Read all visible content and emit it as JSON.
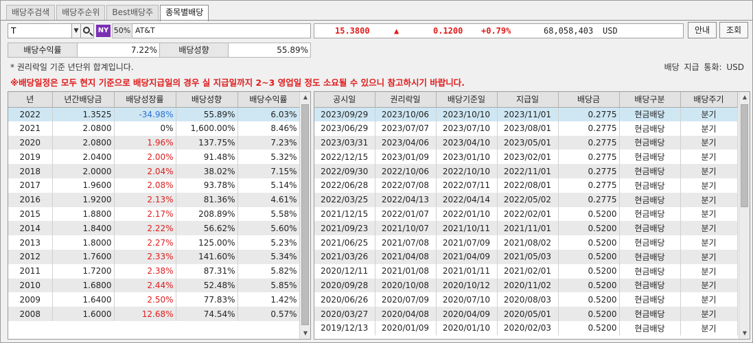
{
  "tabs": [
    {
      "label": "배당주검색",
      "active": false
    },
    {
      "label": "배당주순위",
      "active": false
    },
    {
      "label": "Best배당주",
      "active": false
    },
    {
      "label": "종목별배당",
      "active": true
    }
  ],
  "ticker": {
    "code": "T",
    "exchange_badge": "NY",
    "margin": "50%",
    "name": "AT&T"
  },
  "quote": {
    "price": "15.3800",
    "direction_icon": "up-triangle-icon",
    "direction_symbol": "▲",
    "change": "0.1200",
    "change_pct": "+0.79%",
    "volume": "68,058,403",
    "currency": "USD"
  },
  "buttons": {
    "guide": "안내",
    "query": "조회"
  },
  "summary": {
    "yield_label": "배당수익률",
    "yield_value": "7.22%",
    "payout_label": "배당성향",
    "payout_value": "55.89%"
  },
  "notes": {
    "basis": "* 권리락일 기준 년단위 합계입니다.",
    "currency_label": "배당 지급 통화:",
    "currency_value": "USD",
    "warning": "※배당일정은 모두 현지 기준으로 배당지급일의 경우 실 지급일까지 2~3 영업일 정도 소요될 수 있으니 참고하시기 바랍니다."
  },
  "colors": {
    "up": "#e01b1b",
    "down": "#2b6fd6",
    "badge": "#7b2fb3",
    "selected_row": "#cfe7f3"
  },
  "annual_table": {
    "columns": [
      "년",
      "년간배당금",
      "배당성장률",
      "배당성향",
      "배당수익률"
    ],
    "rows": [
      [
        "2022",
        "1.3525",
        "-34.98%",
        "55.89%",
        "6.03%"
      ],
      [
        "2021",
        "2.0800",
        "0%",
        "1,600.00%",
        "8.46%"
      ],
      [
        "2020",
        "2.0800",
        "1.96%",
        "137.75%",
        "7.23%"
      ],
      [
        "2019",
        "2.0400",
        "2.00%",
        "91.48%",
        "5.32%"
      ],
      [
        "2018",
        "2.0000",
        "2.04%",
        "38.02%",
        "7.15%"
      ],
      [
        "2017",
        "1.9600",
        "2.08%",
        "93.78%",
        "5.14%"
      ],
      [
        "2016",
        "1.9200",
        "2.13%",
        "81.36%",
        "4.61%"
      ],
      [
        "2015",
        "1.8800",
        "2.17%",
        "208.89%",
        "5.58%"
      ],
      [
        "2014",
        "1.8400",
        "2.22%",
        "56.62%",
        "5.60%"
      ],
      [
        "2013",
        "1.8000",
        "2.27%",
        "125.00%",
        "5.23%"
      ],
      [
        "2012",
        "1.7600",
        "2.33%",
        "141.60%",
        "5.34%"
      ],
      [
        "2011",
        "1.7200",
        "2.38%",
        "87.31%",
        "5.82%"
      ],
      [
        "2010",
        "1.6800",
        "2.44%",
        "52.48%",
        "5.85%"
      ],
      [
        "2009",
        "1.6400",
        "2.50%",
        "77.83%",
        "1.42%"
      ],
      [
        "2008",
        "1.6000",
        "12.68%",
        "74.54%",
        "0.57%"
      ]
    ],
    "growth_colors": [
      "down",
      "none",
      "up",
      "up",
      "up",
      "up",
      "up",
      "up",
      "up",
      "up",
      "up",
      "up",
      "up",
      "up",
      "up"
    ]
  },
  "schedule_table": {
    "columns": [
      "공시일",
      "권리락일",
      "배당기준일",
      "지급일",
      "배당금",
      "배당구분",
      "배당주기"
    ],
    "rows": [
      [
        "2023/09/29",
        "2023/10/06",
        "2023/10/10",
        "2023/11/01",
        "0.2775",
        "현금배당",
        "분기"
      ],
      [
        "2023/06/29",
        "2023/07/07",
        "2023/07/10",
        "2023/08/01",
        "0.2775",
        "현금배당",
        "분기"
      ],
      [
        "2023/03/31",
        "2023/04/06",
        "2023/04/10",
        "2023/05/01",
        "0.2775",
        "현금배당",
        "분기"
      ],
      [
        "2022/12/15",
        "2023/01/09",
        "2023/01/10",
        "2023/02/01",
        "0.2775",
        "현금배당",
        "분기"
      ],
      [
        "2022/09/30",
        "2022/10/06",
        "2022/10/10",
        "2022/11/01",
        "0.2775",
        "현금배당",
        "분기"
      ],
      [
        "2022/06/28",
        "2022/07/08",
        "2022/07/11",
        "2022/08/01",
        "0.2775",
        "현금배당",
        "분기"
      ],
      [
        "2022/03/25",
        "2022/04/13",
        "2022/04/14",
        "2022/05/02",
        "0.2775",
        "현금배당",
        "분기"
      ],
      [
        "2021/12/15",
        "2022/01/07",
        "2022/01/10",
        "2022/02/01",
        "0.5200",
        "현금배당",
        "분기"
      ],
      [
        "2021/09/23",
        "2021/10/07",
        "2021/10/11",
        "2021/11/01",
        "0.5200",
        "현금배당",
        "분기"
      ],
      [
        "2021/06/25",
        "2021/07/08",
        "2021/07/09",
        "2021/08/02",
        "0.5200",
        "현금배당",
        "분기"
      ],
      [
        "2021/03/26",
        "2021/04/08",
        "2021/04/09",
        "2021/05/03",
        "0.5200",
        "현금배당",
        "분기"
      ],
      [
        "2020/12/11",
        "2021/01/08",
        "2021/01/11",
        "2021/02/01",
        "0.5200",
        "현금배당",
        "분기"
      ],
      [
        "2020/09/28",
        "2020/10/08",
        "2020/10/12",
        "2020/11/02",
        "0.5200",
        "현금배당",
        "분기"
      ],
      [
        "2020/06/26",
        "2020/07/09",
        "2020/07/10",
        "2020/08/03",
        "0.5200",
        "현금배당",
        "분기"
      ],
      [
        "2020/03/27",
        "2020/04/08",
        "2020/04/09",
        "2020/05/01",
        "0.5200",
        "현금배당",
        "분기"
      ],
      [
        "2019/12/13",
        "2020/01/09",
        "2020/01/10",
        "2020/02/03",
        "0.5200",
        "현금배당",
        "분기"
      ]
    ]
  }
}
